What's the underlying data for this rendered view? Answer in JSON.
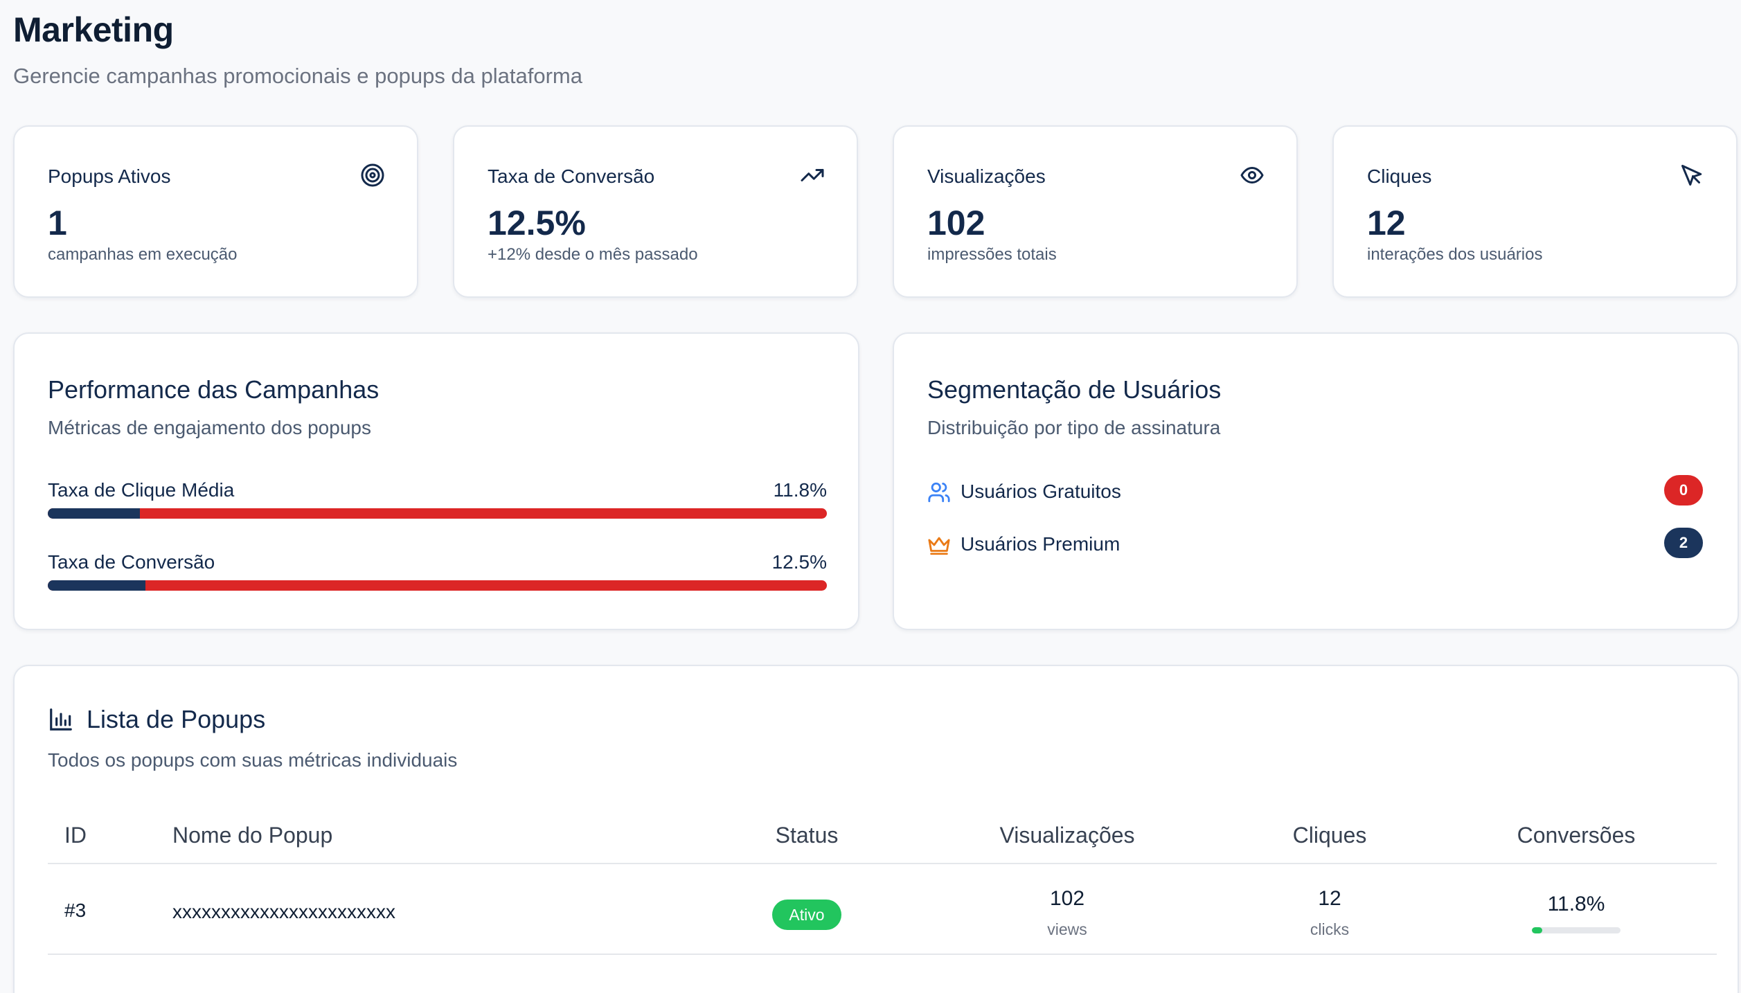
{
  "header": {
    "title": "Marketing",
    "subtitle": "Gerencie campanhas promocionais e popups da plataforma"
  },
  "stats": [
    {
      "label": "Popups Ativos",
      "value": "1",
      "desc": "campanhas em execução",
      "icon": "target-icon"
    },
    {
      "label": "Taxa de Conversão",
      "value": "12.5%",
      "desc": "+12% desde o mês passado",
      "icon": "trending-up-icon"
    },
    {
      "label": "Visualizações",
      "value": "102",
      "desc": "impressões totais",
      "icon": "eye-icon"
    },
    {
      "label": "Cliques",
      "value": "12",
      "desc": "interações dos usuários",
      "icon": "cursor-icon"
    }
  ],
  "performance": {
    "title": "Performance das Campanhas",
    "subtitle": "Métricas de engajamento dos popups",
    "metrics": [
      {
        "label": "Taxa de Clique Média",
        "value": "11.8%",
        "fill_fraction": 0.118
      },
      {
        "label": "Taxa de Conversão",
        "value": "12.5%",
        "fill_fraction": 0.125
      }
    ]
  },
  "segmentation": {
    "title": "Segmentação de Usuários",
    "subtitle": "Distribuição por tipo de assinatura",
    "items": [
      {
        "label": "Usuários Gratuitos",
        "count": "0",
        "icon": "users-icon",
        "badge_color": "#dc2626"
      },
      {
        "label": "Usuários Premium",
        "count": "2",
        "icon": "crown-icon",
        "badge_color": "#1b355c"
      }
    ]
  },
  "popup_list": {
    "title": "Lista de Popups",
    "subtitle": "Todos os popups com suas métricas individuais",
    "columns": [
      "ID",
      "Nome do Popup",
      "Status",
      "Visualizações",
      "Cliques",
      "Conversões"
    ],
    "rows": [
      {
        "id": "#3",
        "name": "xxxxxxxxxxxxxxxxxxxxxxx",
        "status": "Ativo",
        "views": "102",
        "views_unit": "views",
        "clicks": "12",
        "clicks_unit": "clicks",
        "conversion": "11.8%",
        "conversion_fraction": 0.118
      }
    ]
  },
  "colors": {
    "brand_navy": "#13294b",
    "accent_red": "#dc2626",
    "success_green": "#22c55e",
    "background": "#f8f9fb"
  }
}
